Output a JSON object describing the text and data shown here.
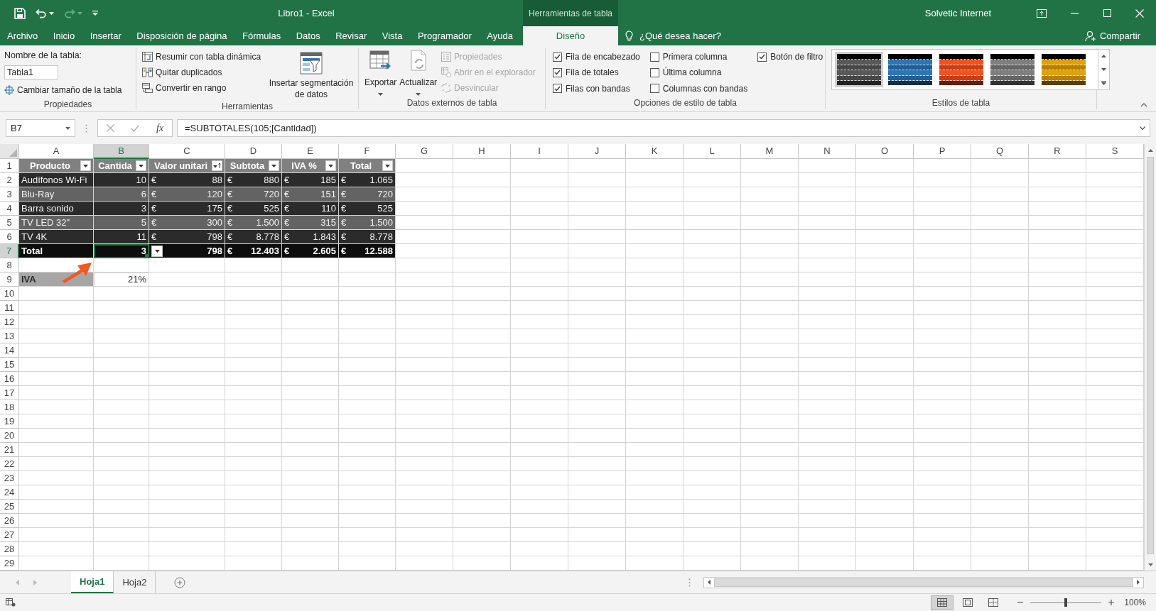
{
  "title_bar": {
    "title": "Libro1  -  Excel",
    "context_group": "Herramientas de tabla",
    "user": "Solvetic Internet",
    "redo_disabled": true
  },
  "ribbon_tabs": [
    {
      "label": "Archivo",
      "selected": false
    },
    {
      "label": "Inicio",
      "selected": false
    },
    {
      "label": "Insertar",
      "selected": false
    },
    {
      "label": "Disposición de página",
      "selected": false
    },
    {
      "label": "Fórmulas",
      "selected": false
    },
    {
      "label": "Datos",
      "selected": false
    },
    {
      "label": "Revisar",
      "selected": false
    },
    {
      "label": "Vista",
      "selected": false
    },
    {
      "label": "Programador",
      "selected": false
    },
    {
      "label": "Ayuda",
      "selected": false
    },
    {
      "label": "Diseño",
      "selected": true
    }
  ],
  "tell_me": "¿Qué desea hacer?",
  "share": "Compartir",
  "ribbon_groups": [
    {
      "kind": "properties",
      "label": "Propiedades",
      "name_label": "Nombre de la tabla:",
      "name_value": "Tabla1",
      "resize_button": "Cambiar tamaño de la tabla"
    },
    {
      "kind": "tools",
      "label": "Herramientas",
      "buttons": [
        "Resumir con tabla dinámica",
        "Quitar duplicados",
        "Convertir en rango"
      ],
      "slicer_button": "Insertar segmentación de datos"
    },
    {
      "kind": "external",
      "label": "Datos externos de tabla",
      "large_buttons": [
        "Exportar",
        "Actualizar"
      ],
      "small_buttons": [
        {
          "label": "Propiedades",
          "disabled": true
        },
        {
          "label": "Abrir en el explorador",
          "disabled": true
        },
        {
          "label": "Desvincular",
          "disabled": true
        }
      ]
    },
    {
      "kind": "style_options",
      "label": "Opciones de estilo de tabla",
      "options": [
        {
          "label": "Fila de encabezado",
          "checked": true
        },
        {
          "label": "Fila de totales",
          "checked": true
        },
        {
          "label": "Filas con bandas",
          "checked": true
        },
        {
          "label": "Primera columna",
          "checked": false
        },
        {
          "label": "Última columna",
          "checked": false
        },
        {
          "label": "Columnas con bandas",
          "checked": false
        },
        {
          "label": "Botón de filtro",
          "checked": true
        }
      ]
    },
    {
      "kind": "styles",
      "label": "Estilos de tabla",
      "swatches": [
        {
          "color": "#595959",
          "selected": true
        },
        {
          "color": "#2e75b6",
          "selected": false
        },
        {
          "color": "#f4511e",
          "selected": false
        },
        {
          "color": "#7f7f7f",
          "selected": false
        },
        {
          "color": "#e0a10a",
          "selected": false
        }
      ]
    }
  ],
  "formula_bar": {
    "name_box": "B7",
    "function_label": "fx",
    "formula": "=SUBTOTALES(105;[Cantidad])"
  },
  "sheet": {
    "columns": [
      {
        "label": "A",
        "selected": false
      },
      {
        "label": "B",
        "selected": true
      },
      {
        "label": "C",
        "selected": false
      },
      {
        "label": "D",
        "selected": false
      },
      {
        "label": "E",
        "selected": false
      },
      {
        "label": "F",
        "selected": false
      },
      {
        "label": "G",
        "selected": false
      },
      {
        "label": "H",
        "selected": false
      },
      {
        "label": "I",
        "selected": false
      },
      {
        "label": "J",
        "selected": false
      },
      {
        "label": "K",
        "selected": false
      },
      {
        "label": "L",
        "selected": false
      },
      {
        "label": "M",
        "selected": false
      },
      {
        "label": "N",
        "selected": false
      },
      {
        "label": "O",
        "selected": false
      },
      {
        "label": "P",
        "selected": false
      },
      {
        "label": "Q",
        "selected": false
      },
      {
        "label": "R",
        "selected": false
      },
      {
        "label": "S",
        "selected": false
      }
    ],
    "rows": [
      {
        "label": "1",
        "selected": false
      },
      {
        "label": "2",
        "selected": false
      },
      {
        "label": "3",
        "selected": false
      },
      {
        "label": "4",
        "selected": false
      },
      {
        "label": "5",
        "selected": false
      },
      {
        "label": "6",
        "selected": false
      },
      {
        "label": "7",
        "selected": true
      },
      {
        "label": "8",
        "selected": false
      },
      {
        "label": "9",
        "selected": false
      },
      {
        "label": "10",
        "selected": false
      },
      {
        "label": "11",
        "selected": false
      },
      {
        "label": "12",
        "selected": false
      },
      {
        "label": "13",
        "selected": false
      },
      {
        "label": "14",
        "selected": false
      },
      {
        "label": "15",
        "selected": false
      },
      {
        "label": "16",
        "selected": false
      },
      {
        "label": "17",
        "selected": false
      },
      {
        "label": "18",
        "selected": false
      },
      {
        "label": "19",
        "selected": false
      },
      {
        "label": "20",
        "selected": false
      },
      {
        "label": "21",
        "selected": false
      },
      {
        "label": "22",
        "selected": false
      },
      {
        "label": "23",
        "selected": false
      },
      {
        "label": "24",
        "selected": false
      },
      {
        "label": "25",
        "selected": false
      },
      {
        "label": "26",
        "selected": false
      },
      {
        "label": "27",
        "selected": false
      },
      {
        "label": "28",
        "selected": false
      },
      {
        "label": "29",
        "selected": false
      }
    ]
  },
  "table": {
    "headers": [
      {
        "label": "Producto",
        "kind": "filter"
      },
      {
        "label": "Cantida",
        "kind": "filter"
      },
      {
        "label": "Valor unitari",
        "kind": "sort_filter"
      },
      {
        "label": "Subtota",
        "kind": "filter"
      },
      {
        "label": "IVA %",
        "kind": "filter"
      },
      {
        "label": "Total",
        "kind": "filter"
      }
    ],
    "rows": [
      {
        "cells": [
          {
            "text": "Audífonos Wi-Fi"
          },
          {
            "text": "10"
          },
          {
            "symbol": "€",
            "text": "88"
          },
          {
            "symbol": "€",
            "text": "880"
          },
          {
            "symbol": "€",
            "text": "185"
          },
          {
            "symbol": "€",
            "text": "1.065"
          }
        ]
      },
      {
        "cells": [
          {
            "text": "Blu-Ray"
          },
          {
            "text": "6"
          },
          {
            "symbol": "€",
            "text": "120"
          },
          {
            "symbol": "€",
            "text": "720"
          },
          {
            "symbol": "€",
            "text": "151"
          },
          {
            "symbol": "€",
            "text": "720"
          }
        ]
      },
      {
        "cells": [
          {
            "text": "Barra sonido"
          },
          {
            "text": "3"
          },
          {
            "symbol": "€",
            "text": "175"
          },
          {
            "symbol": "€",
            "text": "525"
          },
          {
            "symbol": "€",
            "text": "110"
          },
          {
            "symbol": "€",
            "text": "525"
          }
        ]
      },
      {
        "cells": [
          {
            "text": "TV LED 32\""
          },
          {
            "text": "5"
          },
          {
            "symbol": "€",
            "text": "300"
          },
          {
            "symbol": "€",
            "text": "1.500"
          },
          {
            "symbol": "€",
            "text": "315"
          },
          {
            "symbol": "€",
            "text": "1.500"
          }
        ]
      },
      {
        "cells": [
          {
            "text": "TV 4K"
          },
          {
            "text": "11"
          },
          {
            "symbol": "€",
            "text": "798"
          },
          {
            "symbol": "€",
            "text": "8.778"
          },
          {
            "symbol": "€",
            "text": "1.843"
          },
          {
            "symbol": "€",
            "text": "8.778"
          }
        ]
      }
    ],
    "total_row": {
      "cells": [
        {
          "text": "Total",
          "selected": false
        },
        {
          "text": "3",
          "selected": true,
          "dropdown": true
        },
        {
          "text": "798",
          "selected": false
        },
        {
          "symbol": "€",
          "text": "12.403",
          "selected": false
        },
        {
          "symbol": "€",
          "text": "2.605",
          "selected": false
        },
        {
          "symbol": "€",
          "text": "12.588",
          "selected": false
        }
      ]
    }
  },
  "iva_row": {
    "label": "IVA",
    "value": "21%"
  },
  "sheet_tabs": [
    {
      "label": "Hoja1",
      "selected": true
    },
    {
      "label": "Hoja2",
      "selected": false
    }
  ],
  "status_bar": {
    "views": [
      {
        "kind": "normal",
        "selected": true
      },
      {
        "kind": "page_layout",
        "selected": false
      },
      {
        "kind": "page_break",
        "selected": false
      }
    ],
    "zoom": {
      "level": 0.5,
      "reading": "100%"
    }
  }
}
